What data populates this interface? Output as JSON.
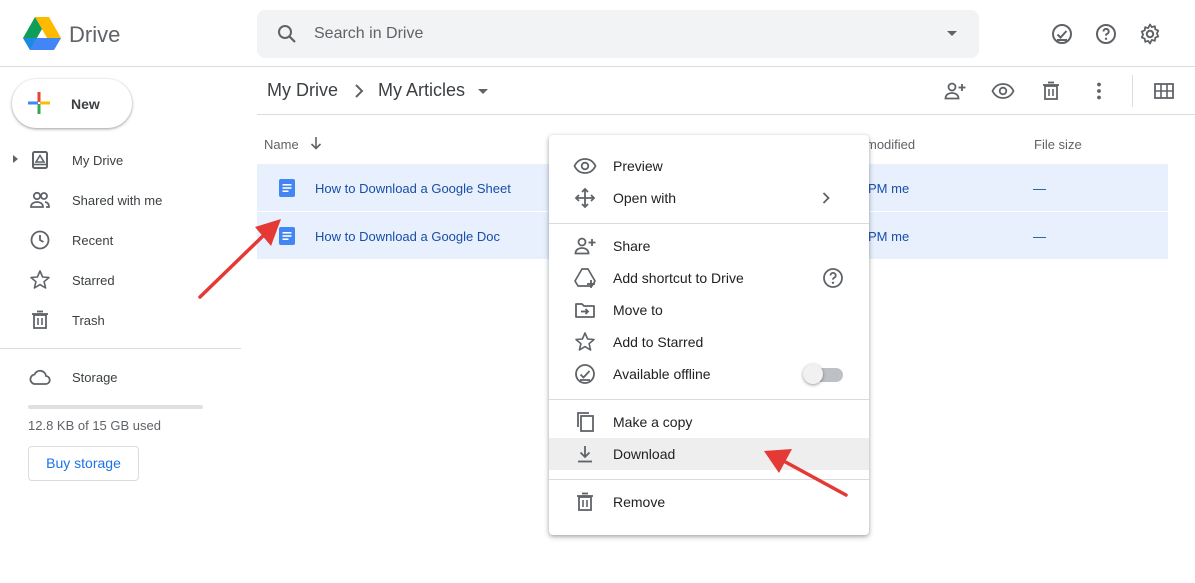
{
  "app": {
    "name": "Drive"
  },
  "search": {
    "placeholder": "Search in Drive"
  },
  "sidebar": {
    "new_label": "New",
    "items": [
      {
        "label": "My Drive",
        "icon": "my-drive-icon"
      },
      {
        "label": "Shared with me",
        "icon": "shared-icon"
      },
      {
        "label": "Recent",
        "icon": "clock-icon"
      },
      {
        "label": "Starred",
        "icon": "star-icon"
      },
      {
        "label": "Trash",
        "icon": "trash-icon"
      }
    ],
    "storage": {
      "label": "Storage",
      "used_text": "12.8 KB of 15 GB used",
      "used_fraction": 0.0,
      "buy_label": "Buy storage"
    }
  },
  "breadcrumb": {
    "root": "My Drive",
    "current": "My Articles"
  },
  "table": {
    "columns": {
      "name": "Name",
      "modified": "modified",
      "size": "File size"
    },
    "rows": [
      {
        "name": "How to Download a Google Sheet",
        "modified": "PM  me",
        "size": "—"
      },
      {
        "name": "How to Download a Google Doc",
        "modified": "PM  me",
        "size": "—"
      }
    ]
  },
  "context_menu": {
    "items": [
      {
        "label": "Preview",
        "icon": "eye-icon"
      },
      {
        "label": "Open with",
        "icon": "move-arrows-icon"
      },
      {
        "label": "Share",
        "icon": "person-add-icon"
      },
      {
        "label": "Add shortcut to Drive",
        "icon": "shortcut-icon"
      },
      {
        "label": "Move to",
        "icon": "folder-move-icon"
      },
      {
        "label": "Add to Starred",
        "icon": "star-icon"
      },
      {
        "label": "Available offline",
        "icon": "offline-check-icon",
        "toggle_on": false
      },
      {
        "label": "Make a copy",
        "icon": "copy-icon"
      },
      {
        "label": "Download",
        "icon": "download-icon",
        "highlighted": true
      },
      {
        "label": "Remove",
        "icon": "trash-icon"
      }
    ]
  },
  "colors": {
    "selection": "#e8f0fe",
    "link": "#174ea6",
    "accent": "#1a73e8",
    "annotation_arrow": "#e53935"
  }
}
